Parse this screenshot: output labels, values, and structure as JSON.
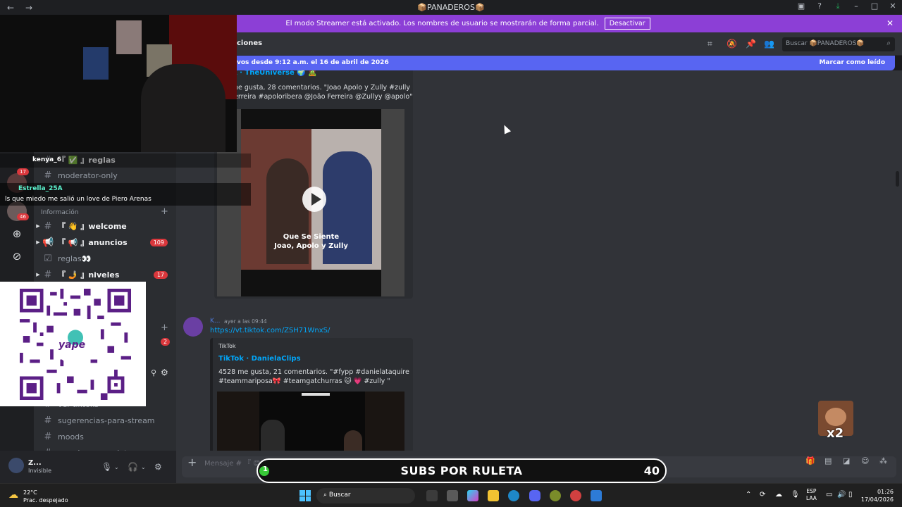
{
  "window": {
    "title": "📦PANADEROS📦",
    "nav_back": "←",
    "nav_forward": "→"
  },
  "banner": {
    "text": "El modo Streamer está activado. Los nombres de usuario se mostrarán de forma parcial.",
    "button": "Desactivar"
  },
  "rail": {
    "badges": [
      "17",
      "46"
    ]
  },
  "sidebar": {
    "channels_top": [
      {
        "label": "『 ✅ 』reglas",
        "bright": true
      },
      {
        "label": "moderator-only",
        "bright": false
      }
    ],
    "category_info": "Información",
    "channels_info": [
      {
        "label": "『 👋 』welcome",
        "bright": true,
        "count": ""
      },
      {
        "label": "『 📢 』anuncios",
        "bright": true,
        "count": "109"
      },
      {
        "label": "reglas👀",
        "bright": false,
        "count": ""
      },
      {
        "label": "『 🤳 』niveles",
        "bright": true,
        "count": "17"
      }
    ],
    "extra_badge": "2",
    "channels_bottom": [
      {
        "label": "ver-tiktoks"
      },
      {
        "label": "sugerencias-para-stream"
      },
      {
        "label": "moods"
      },
      {
        "label": "manden-sus-calatos"
      }
    ]
  },
  "user": {
    "name": "Z...",
    "status": "Invisible"
  },
  "header": {
    "title": "ciones",
    "search_placeholder": "Buscar 📦PANADEROS📦"
  },
  "newbar": {
    "left": "vos desde 9:12 a.m. el 16 de abril de 2026",
    "right": "Marcar como leído"
  },
  "message1": {
    "embed_author": "k · TheUniverse 🌍 🧟",
    "embed_desc_1": "ne gusta, 28 comentarios. \"Joao Apolo y Zully #zully",
    "embed_desc_2": "erreira #apoloribera @João Ferreira @Zullyy @apolo\"",
    "video_caption_1": "Que Se Siente",
    "video_caption_2": "Joao, Apolo y Zully"
  },
  "message2": {
    "author": "K...",
    "time": "ayer a las 09:44",
    "link": "https://vt.tiktok.com/ZSH71WnxS/",
    "provider": "TikTok",
    "embed_title": "TikTok · DanielaClips",
    "embed_desc_1": "4528 me gusta, 21 comentarios. \"#fypp #danielataquire",
    "embed_desc_2": "#teammariposa🎀 #teamgatchurras 🐱 💗 #zully \""
  },
  "input": {
    "placeholder": "Mensaje # 『 😊 』reacciones"
  },
  "overlay": {
    "chat_user_1": "kenya_6",
    "chat_user_2": "Estrella_25A",
    "chat_msg": "ls que miedo me salió un love de Piero Arenas",
    "roulette_label": "SUBS POR RULETA",
    "roulette_value": "40",
    "roulette_dot": "1",
    "qr_brand": "yape",
    "emote_mult": "x2"
  },
  "taskbar": {
    "temp": "22°C",
    "weather": "Prac. despejado",
    "search": "Buscar",
    "lang_1": "ESP",
    "lang_2": "LAA",
    "time": "01:26",
    "date": "17/04/2026"
  },
  "colors": {
    "accent": "#5865f2",
    "banner": "#8c3fd6",
    "link": "#00a8fc",
    "badge": "#da373c"
  }
}
